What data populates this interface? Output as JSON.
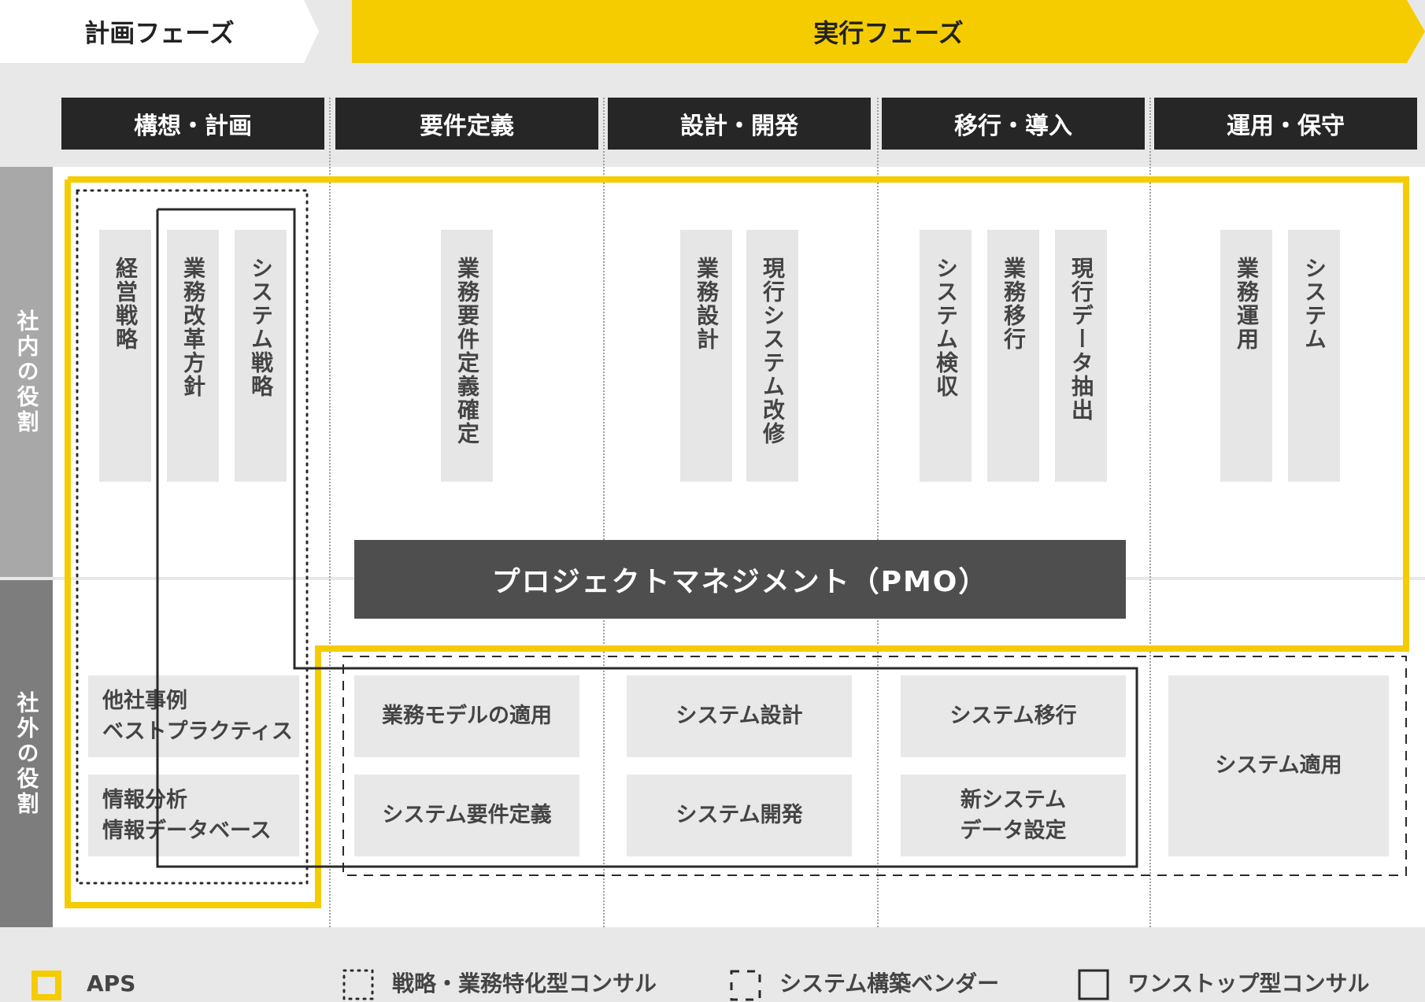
{
  "phases": {
    "plan": "計画フェーズ",
    "exec": "実行フェーズ"
  },
  "stages": [
    "構想・計画",
    "要件定義",
    "設計・開発",
    "移行・導入",
    "運用・保守"
  ],
  "roles": {
    "internal": "社内の役割",
    "external": "社外の役割"
  },
  "internal_tasks": [
    "経営戦略",
    "業務改革方針",
    "システム戦略",
    "業務要件定義確定",
    "業務設計",
    "現行システム改修",
    "システム検収",
    "業務移行",
    "現行データ抽出",
    "業務運用",
    "システム"
  ],
  "pmo": "プロジェクトマネジメント（PMO）",
  "external_tasks": {
    "case_line1": "他社事例",
    "case_line2": "ベストプラクティス",
    "info_line1": "情報分析",
    "info_line2": "情報データベース",
    "business_model": "業務モデルの適用",
    "sys_requirements": "システム要件定義",
    "sys_design": "システム設計",
    "sys_dev": "システム開発",
    "sys_migration": "システム移行",
    "newsys_line1": "新システム",
    "newsys_line2": "データ設定",
    "sys_apply": "システム適用"
  },
  "legend": {
    "aps": "APS",
    "strategy": "戦略・業務特化型コンサル",
    "vendor": "システム構築ベンダー",
    "onestop": "ワンストップ型コンサル"
  },
  "colors": {
    "accent": "#f5cc00",
    "header": "#262626",
    "pmo": "#4e4e4e",
    "box": "#e6e6e6"
  }
}
